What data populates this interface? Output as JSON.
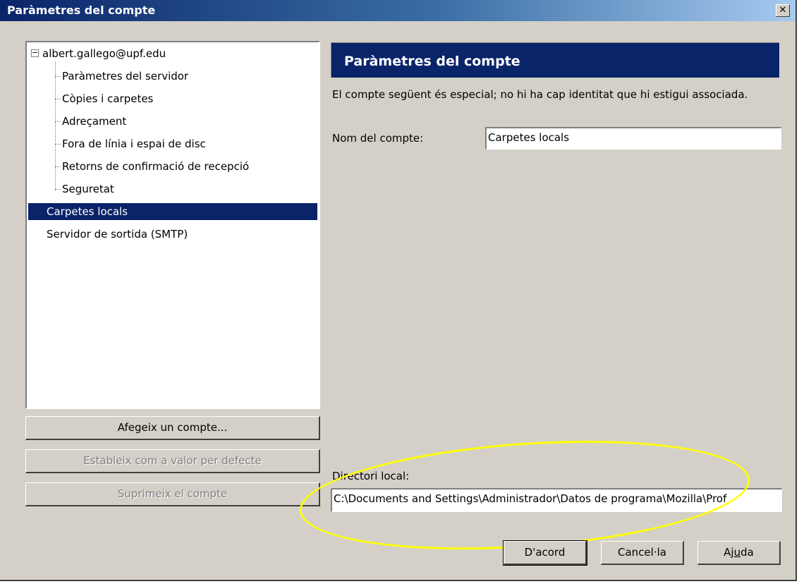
{
  "window": {
    "title": "Paràmetres del compte",
    "close_glyph": "✕"
  },
  "tree": {
    "account": "albert.gallego@upf.edu",
    "expander_glyph": "−",
    "children": [
      "Paràmetres del servidor",
      "Còpies i carpetes",
      "Adreçament",
      "Fora de línia i espai de disc",
      "Retorns de confirmació de recepció",
      "Seguretat"
    ],
    "local_folders": "Carpetes locals",
    "smtp": "Servidor de sortida (SMTP)"
  },
  "left_buttons": {
    "add_account": "Afegeix un compte...",
    "set_default": "Estableix com a valor per defecte",
    "remove_account": "Suprimeix el compte"
  },
  "panel": {
    "header": "Paràmetres del compte",
    "description": "El compte següent és especial; no hi ha cap identitat que hi estigui associada.",
    "account_name_label": "Nom del compte:",
    "account_name_value": "Carpetes locals",
    "local_dir_label": "Directori local:",
    "local_dir_value": "C:\\Documents and Settings\\Administrador\\Datos de programa\\Mozilla\\Prof"
  },
  "dialog_buttons": {
    "ok": "D'acord",
    "cancel": "Cancel·la",
    "help_pre": "Aj",
    "help_mnemonic": "u",
    "help_post": "da"
  },
  "colors": {
    "highlight_ring": "#ffff00",
    "selection": "#0a246a"
  }
}
